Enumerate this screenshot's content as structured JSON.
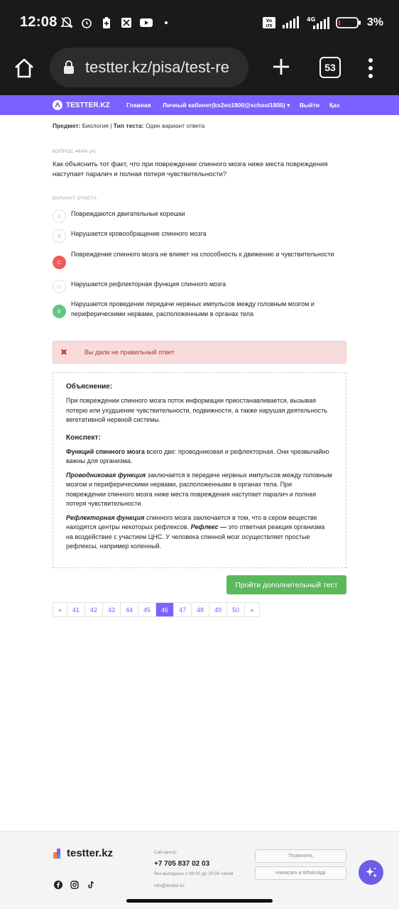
{
  "status_bar": {
    "time": "12:08",
    "battery": "3%",
    "network": "4G"
  },
  "browser": {
    "url": "testter.kz/pisa/test-re",
    "tab_count": "53"
  },
  "navbar": {
    "brand": "TESTTER.KZ",
    "items": [
      "Главная",
      "Личный кабинет(ks2eo1800@school1800)",
      "Выйти",
      "Қаз"
    ]
  },
  "meta": {
    "subject_label": "Предмет:",
    "subject": "Биология",
    "type_label": "Тип теста:",
    "type": "Один вариант ответа"
  },
  "question": {
    "label": "ВОПРОС 46/84 (А)",
    "text": "Как объяснить тот факт,  что при повреждении спинного  мозга ниже места повреждения наступает паралич и полная потеря чувствительности?"
  },
  "answers_label": "ВАРИАНТ ОТВЕТА",
  "options": [
    {
      "letter": "A",
      "text": "Повреждаются двигательные корешки",
      "state": "none"
    },
    {
      "letter": "B",
      "text": "Нарушается кровообращение спинного мозга",
      "state": "none"
    },
    {
      "letter": "C",
      "text": "Повреждение спинного мозга не влияет на способность к движению и чувствительности",
      "state": "wrong"
    },
    {
      "letter": "D",
      "text": "Нарушается рефлекторная функция спинного мозга",
      "state": "none"
    },
    {
      "letter": "E",
      "text": "Нарушается проведение передачи нервных импульсов между головным мозгом и периферическими нервами, расположенными в органах тела",
      "state": "correct"
    }
  ],
  "alert": {
    "text": "Вы дали не правильный ответ"
  },
  "explanation": {
    "title": "Объяснение:",
    "text": "При повреждении спинного мозга поток информации приостанавливается, вызывая потерю или ухудшение чувствительности, подвижности, а также нарушая деятельность вегетативной нервной системы.",
    "summary_title": "Конспект:",
    "p1_bold": "Функций спинного мозга",
    "p1_rest": " всего две: проводниковая и рефлекторная. Они чрезвычайно важны для организма.",
    "p2_bold": "Проводниковая функция",
    "p2_rest": " заключается в передаче нервных импульсов между головным мозгом и периферическими нервами, расположенными в органах тела. При повреждении спинного мозга ниже места повреждения наступает паралич и полная потеря чувствительности.",
    "p3_bold": "Рефлекторная функция",
    "p3_mid": " спинного мозга заключается в том, что в сером веществе находятся центры некоторых рефлексов. ",
    "p3_bold2": "Рефлекс —",
    "p3_rest": " это ответная реакция организма на воздействие с участием ЦНС. У человека спинной мозг осуществляет простые рефлексы, например коленный."
  },
  "more_button": "Пройти дополнительный тест",
  "pagination": {
    "prev": "«",
    "next": "»",
    "pages": [
      "41",
      "42",
      "43",
      "44",
      "45",
      "46",
      "47",
      "48",
      "49",
      "50"
    ],
    "active": "46"
  },
  "footer": {
    "logo": "testter.kz",
    "callcenter_label": "Call-центр:",
    "phone": "+7 705 837 02 03",
    "hours": "без выходных с 08:00 до 20:00 часов",
    "email": "info@testter.kz",
    "call_button": "Позвонить",
    "whatsapp_button": "Написать в WhatsApp"
  },
  "colors": {
    "accent": "#7b61ff",
    "wrong": "#ef5b5b",
    "correct": "#5fc883",
    "alert_bg": "#f8dcdc",
    "button_green": "#5cb85c"
  }
}
